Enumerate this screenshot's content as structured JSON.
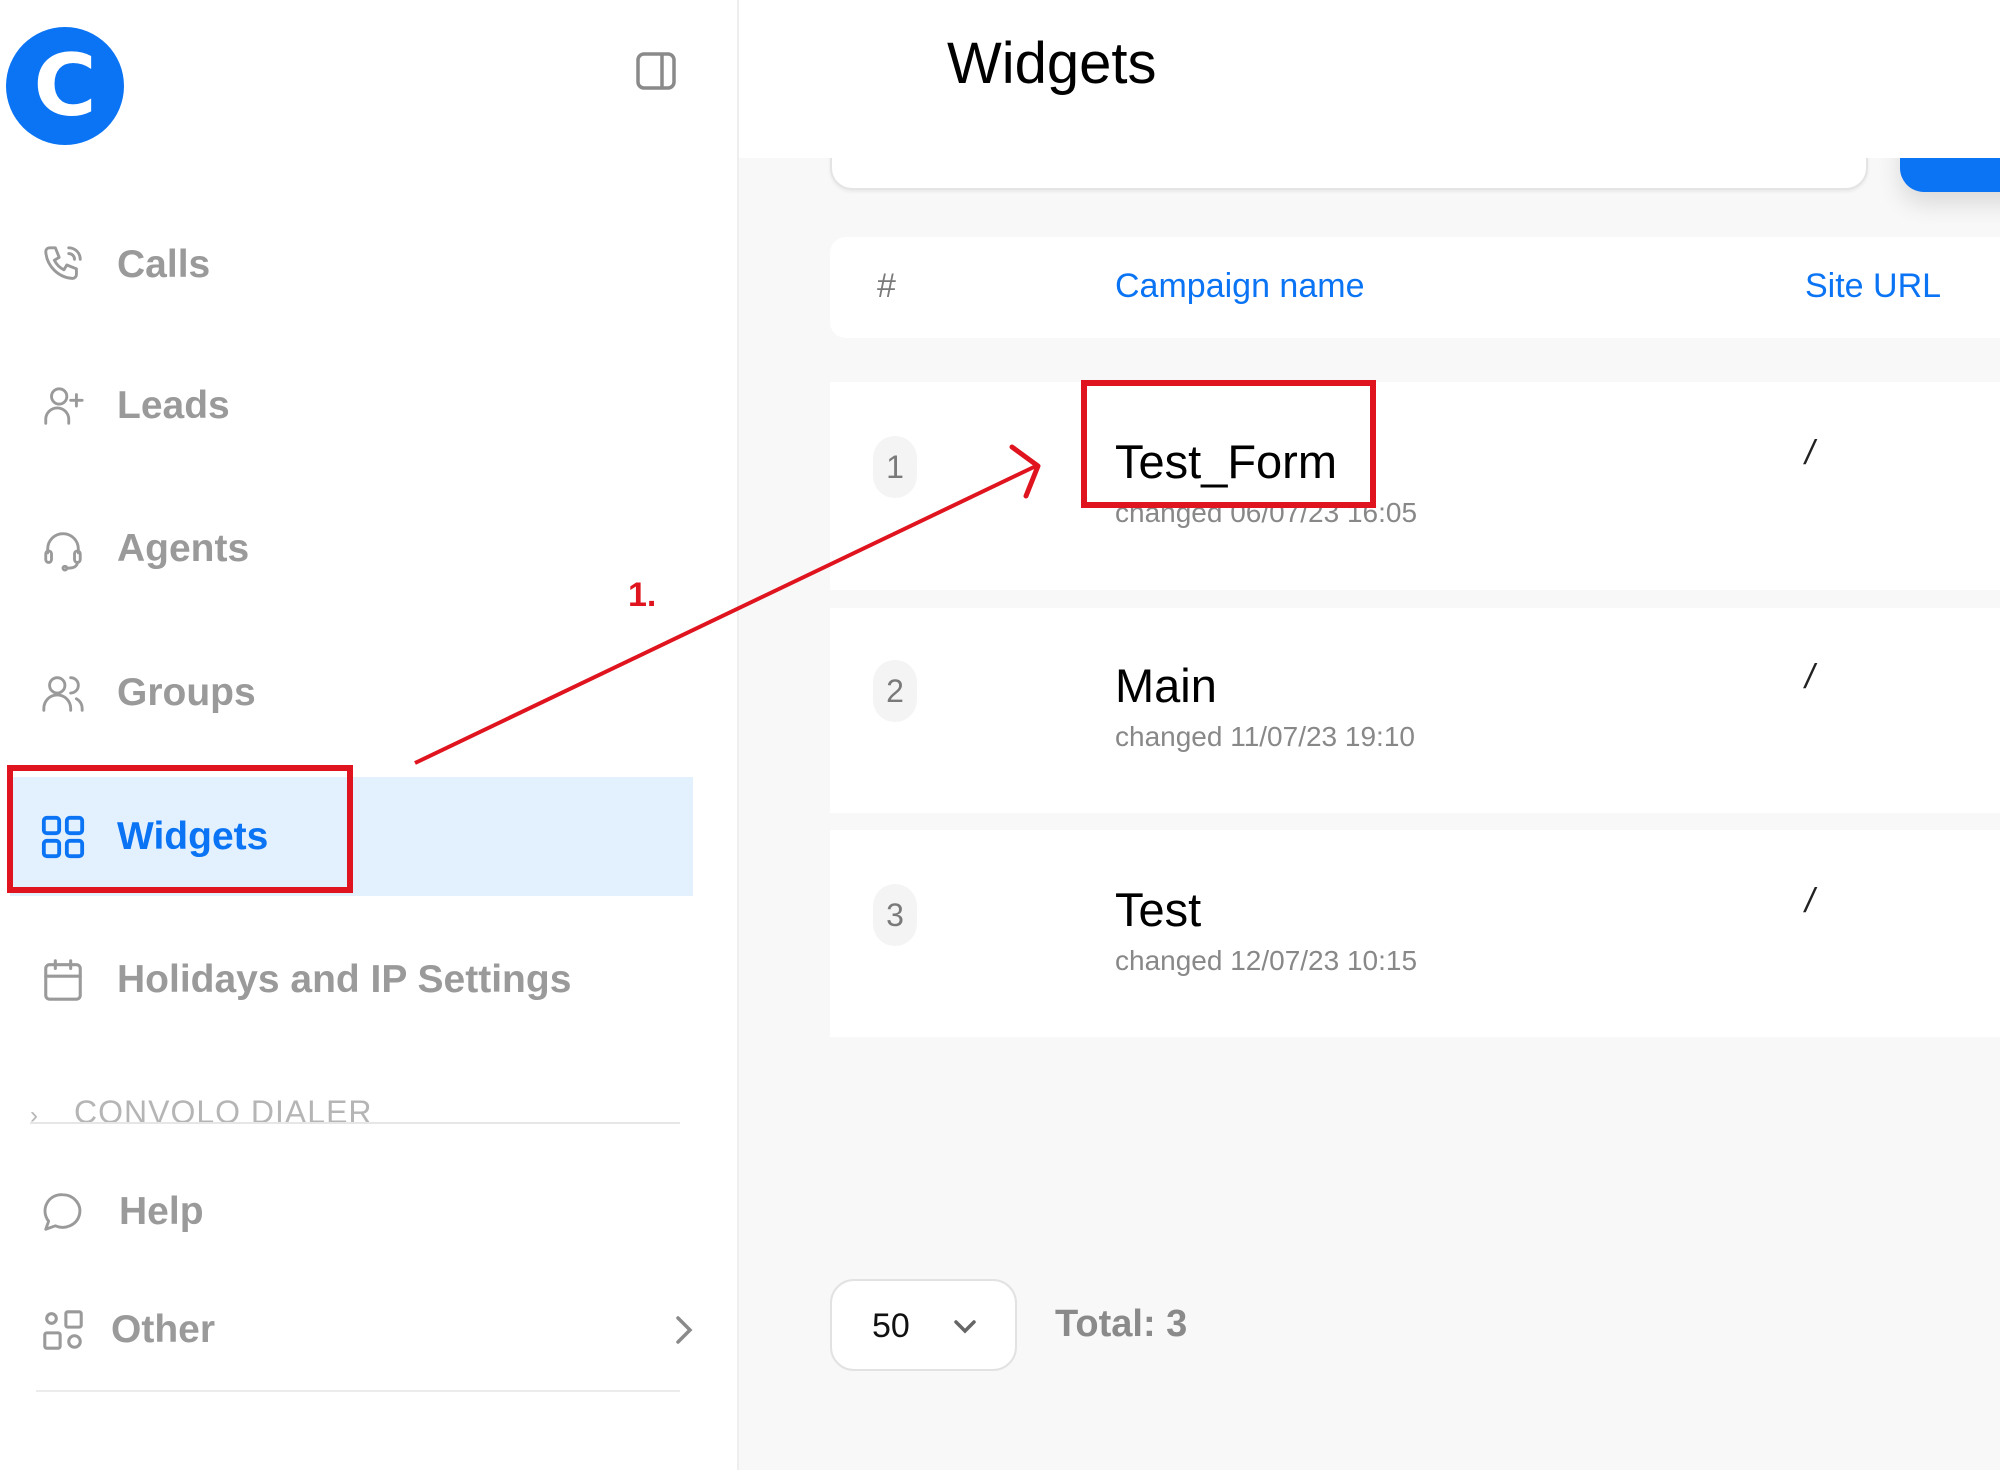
{
  "app": {
    "logo_letter": "C",
    "brand_color": "#0a74f5"
  },
  "sidebar": {
    "items": [
      {
        "label": "Calls",
        "icon": "phone-icon"
      },
      {
        "label": "Leads",
        "icon": "user-plus-icon"
      },
      {
        "label": "Agents",
        "icon": "headset-icon"
      },
      {
        "label": "Groups",
        "icon": "users-icon"
      },
      {
        "label": "Widgets",
        "icon": "grid-icon",
        "active": true
      },
      {
        "label": "Holidays and IP Settings",
        "icon": "calendar-icon"
      }
    ],
    "section_label": "CONVOLO DIALER",
    "bottom_items": [
      {
        "label": "Help",
        "icon": "chat-bubble-icon"
      },
      {
        "label": "Other",
        "icon": "shapes-icon"
      }
    ]
  },
  "header": {
    "title": "Widgets"
  },
  "table": {
    "columns": [
      "#",
      "Campaign name",
      "Site URL"
    ],
    "rows": [
      {
        "num": "1",
        "name": "Test_Form",
        "changed": "changed 06/07/23 16:05",
        "url": "/"
      },
      {
        "num": "2",
        "name": "Main",
        "changed": "changed 11/07/23 19:10",
        "url": "/"
      },
      {
        "num": "3",
        "name": "Test",
        "changed": "changed 12/07/23 10:15",
        "url": "/"
      }
    ]
  },
  "pagination": {
    "page_size": "50",
    "total_label": "Total: 3"
  },
  "annotations": {
    "step_label": "1.",
    "color": "#e0141e"
  }
}
